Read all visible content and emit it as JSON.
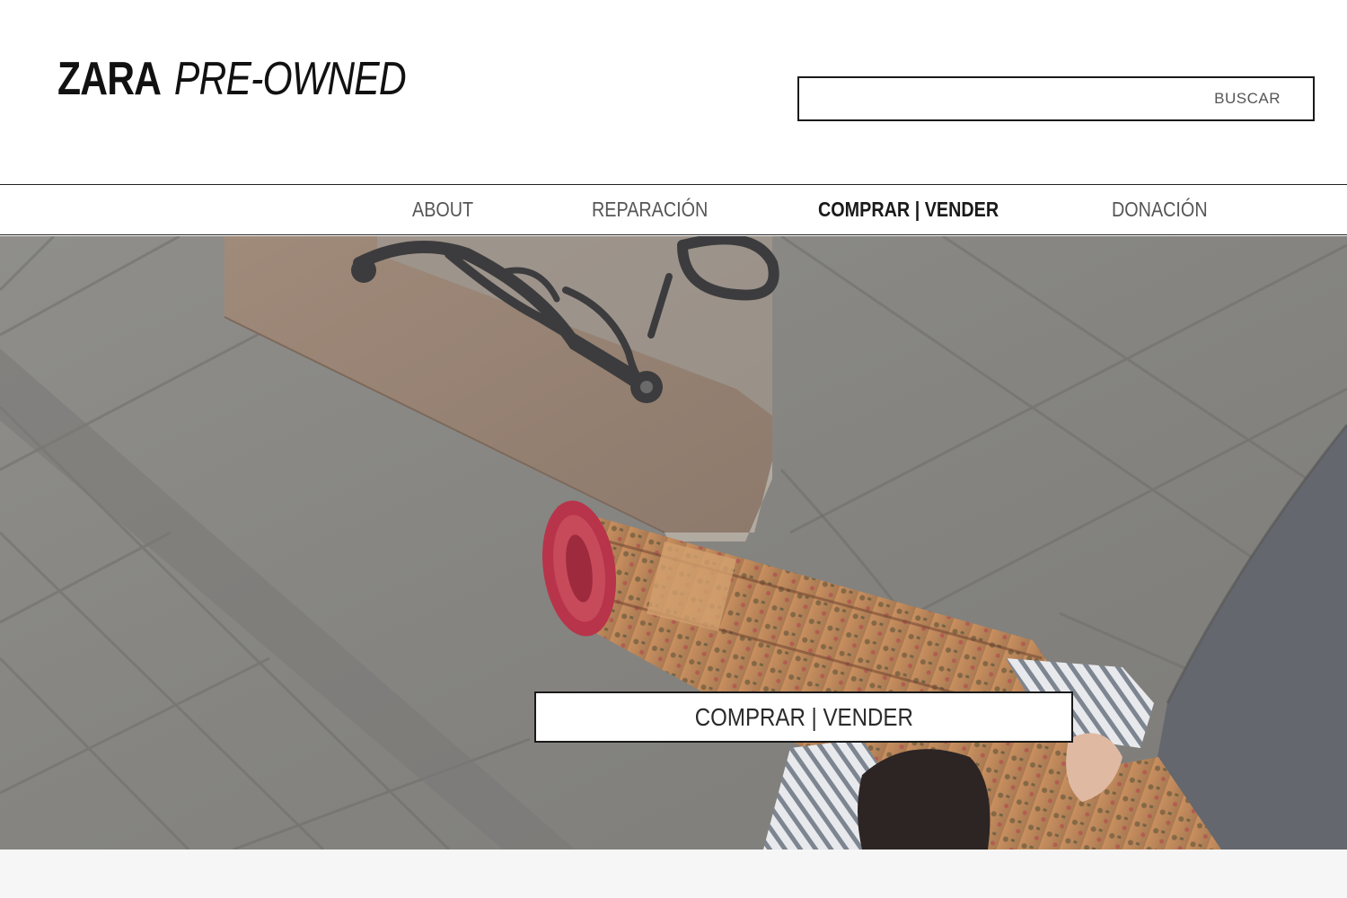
{
  "header": {
    "logo_brand": "ZARA",
    "logo_sub": "PRE-OWNED",
    "search": {
      "value": "",
      "placeholder": "",
      "button_label": "BUSCAR"
    }
  },
  "nav": {
    "items": [
      {
        "label": "ABOUT",
        "active": false
      },
      {
        "label": "REPARACIÓN",
        "active": false
      },
      {
        "label": "COMPRAR | VENDER",
        "active": true
      },
      {
        "label": "DONACIÓN",
        "active": false
      }
    ]
  },
  "hero": {
    "cta_label": "COMPRAR | VENDER"
  },
  "colors": {
    "text": "#1a1a1a",
    "nav_inactive": "#555555",
    "background": "#ffffff",
    "pavement": "#8c8b87",
    "rug_red": "#b8344a",
    "rug_tan": "#c8935e"
  }
}
